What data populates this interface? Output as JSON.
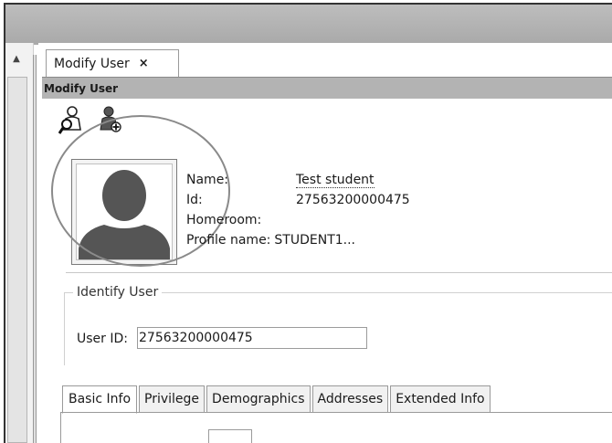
{
  "tab": {
    "label": "Modify User",
    "close_glyph": "×"
  },
  "panel": {
    "title": "Modify User"
  },
  "toolbar": {
    "icons": [
      "find-user-icon",
      "add-user-icon"
    ]
  },
  "profile": {
    "fields": [
      {
        "label": "Name:",
        "value": "Test student"
      },
      {
        "label": "Id:",
        "value": "27563200000475"
      },
      {
        "label": "Homeroom:",
        "value": ""
      },
      {
        "label": "Profile name:",
        "value": "STUDENT1..."
      }
    ]
  },
  "identify": {
    "legend": "Identify User",
    "user_id_label": "User ID:",
    "user_id_value": "27563200000475"
  },
  "sub_tabs": [
    "Basic Info",
    "Privilege",
    "Demographics",
    "Addresses",
    "Extended Info"
  ],
  "scroll": {
    "up_glyph": "▲"
  }
}
